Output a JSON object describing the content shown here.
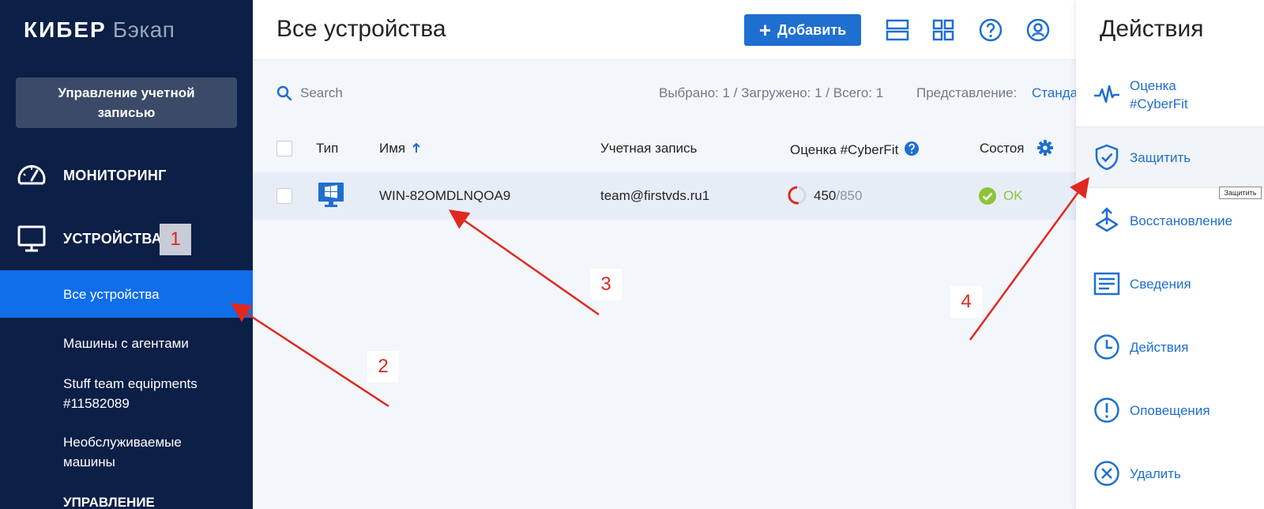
{
  "sidebar": {
    "logo_bold": "КИБЕР",
    "logo_light": "Бэкап",
    "account_button": "Управление учетной записью",
    "sections": {
      "monitoring": "МОНИТОРИНГ",
      "devices": "УСТРОЙСТВА",
      "management": "УПРАВЛЕНИЕ"
    },
    "items": [
      {
        "label": "Все устройства"
      },
      {
        "label": "Машины с агентами"
      },
      {
        "label": "Stuff team equipments #11582089"
      },
      {
        "label": "Необслуживаемые машины"
      }
    ]
  },
  "header": {
    "title": "Все устройства",
    "add_button": "Добавить",
    "icons": [
      "list-view-icon",
      "grid-view-icon",
      "help-icon",
      "user-profile-icon"
    ]
  },
  "toolbar": {
    "search_placeholder": "Search",
    "counts": "Выбрано: 1 / Загружено: 1 / Всего: 1",
    "view_label": "Представление:",
    "view_value": "Стандартное"
  },
  "table": {
    "columns": {
      "type": "Тип",
      "name": "Имя",
      "account": "Учетная запись",
      "cyberfit": "Оценка #CyberFit",
      "status": "Состоя"
    },
    "rows": [
      {
        "name": "WIN-82OMDLNQOA9",
        "account": "team@firstvds.ru1",
        "score": "450",
        "score_max": "/850",
        "status": "OK"
      }
    ]
  },
  "panel": {
    "title": "Действия",
    "actions": [
      {
        "label": "Оценка #CyberFit",
        "icon": "pulse-icon"
      },
      {
        "label": "Защитить",
        "icon": "shield-icon"
      },
      {
        "label": "Восстановление",
        "icon": "restore-icon"
      },
      {
        "label": "Сведения",
        "icon": "details-icon"
      },
      {
        "label": "Действия",
        "icon": "clock-icon"
      },
      {
        "label": "Оповещения",
        "icon": "alert-icon"
      },
      {
        "label": "Удалить",
        "icon": "delete-icon"
      }
    ],
    "tooltip": "Защитить"
  },
  "annotations": [
    "1",
    "2",
    "3",
    "4"
  ],
  "colors": {
    "sidebar_bg": "#0b1f47",
    "active_item": "#0f6ee8",
    "accent": "#1e6fd0",
    "status_ok": "#8cc43a",
    "annotation": "#e0281e"
  }
}
